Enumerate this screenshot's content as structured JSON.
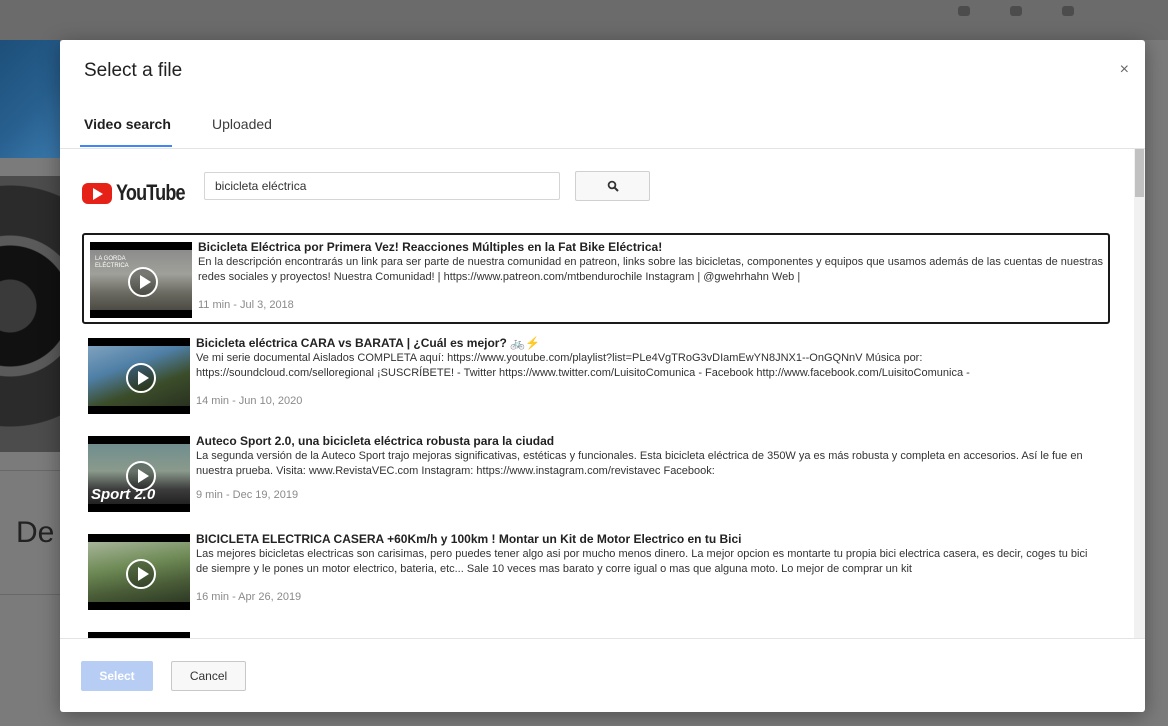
{
  "background": {
    "heading_fragment": "De"
  },
  "dialog": {
    "title": "Select a file",
    "close_label": "×",
    "tabs": [
      {
        "label": "Video search",
        "active": true
      },
      {
        "label": "Uploaded",
        "active": false
      }
    ]
  },
  "search": {
    "brand": "YouTube",
    "query": "bicicleta eléctrica",
    "button_icon": "search-icon"
  },
  "results": [
    {
      "title": "Bicicleta Eléctrica por Primera Vez! Reacciones Múltiples en la Fat Bike Eléctrica!",
      "description": "En la descripción encontrarás un link para ser parte de nuestra comunidad en patreon, links sobre las bicicletas, componentes y equipos que usamos además de las cuentas de nuestras redes sociales y proyectos! Nuestra Comunidad! | https://www.patreon.com/mtbendurochile Instagram | @gwehrhahn Web |",
      "meta": "11 min - Jul 3, 2018",
      "thumb_text": "LA GORDA ELÉCTRICA",
      "selected": true
    },
    {
      "title": "Bicicleta eléctrica CARA vs BARATA | ¿Cuál es mejor? 🚲⚡",
      "description": "Ve mi serie documental Aislados COMPLETA aquí: https://www.youtube.com/playlist?list=PLe4VgTRoG3vDIamEwYN8JNX1--OnGQNnV Música por: https://soundcloud.com/selloregional ¡SUSCRÍBETE! - Twitter https://www.twitter.com/LuisitoComunica - Facebook http://www.facebook.com/LuisitoComunica -",
      "meta": "14 min - Jun 10, 2020",
      "thumb_text": "",
      "selected": false
    },
    {
      "title": "Auteco Sport 2.0, una bicicleta eléctrica robusta para la ciudad",
      "description": "La segunda versión de la Auteco Sport trajo mejoras significativas, estéticas y funcionales. Esta bicicleta eléctrica de 350W ya es más robusta y completa en accesorios. Así le fue en nuestra prueba. Visita: www.RevistaVEC.com Instagram: https://www.instagram.com/revistavec Facebook:",
      "meta": "9 min - Dec 19, 2019",
      "thumb_text": "Sport 2.0",
      "selected": false
    },
    {
      "title": "BICICLETA ELECTRICA CASERA +60Km/h y 100km ! Montar un Kit de Motor Electrico en tu Bici",
      "description": "Las mejores bicicletas electricas son carisimas, pero puedes tener algo asi por mucho menos dinero. La mejor opcion es montarte tu propia bici electrica casera, es decir, coges tu bici de siempre y le pones un motor electrico, bateria, etc... Sale 10 veces mas barato y corre igual o mas que alguna moto. Lo mejor de comprar un kit",
      "meta": "16 min - Apr 26, 2019",
      "thumb_text": "",
      "selected": false
    }
  ],
  "footer": {
    "select_label": "Select",
    "cancel_label": "Cancel"
  }
}
